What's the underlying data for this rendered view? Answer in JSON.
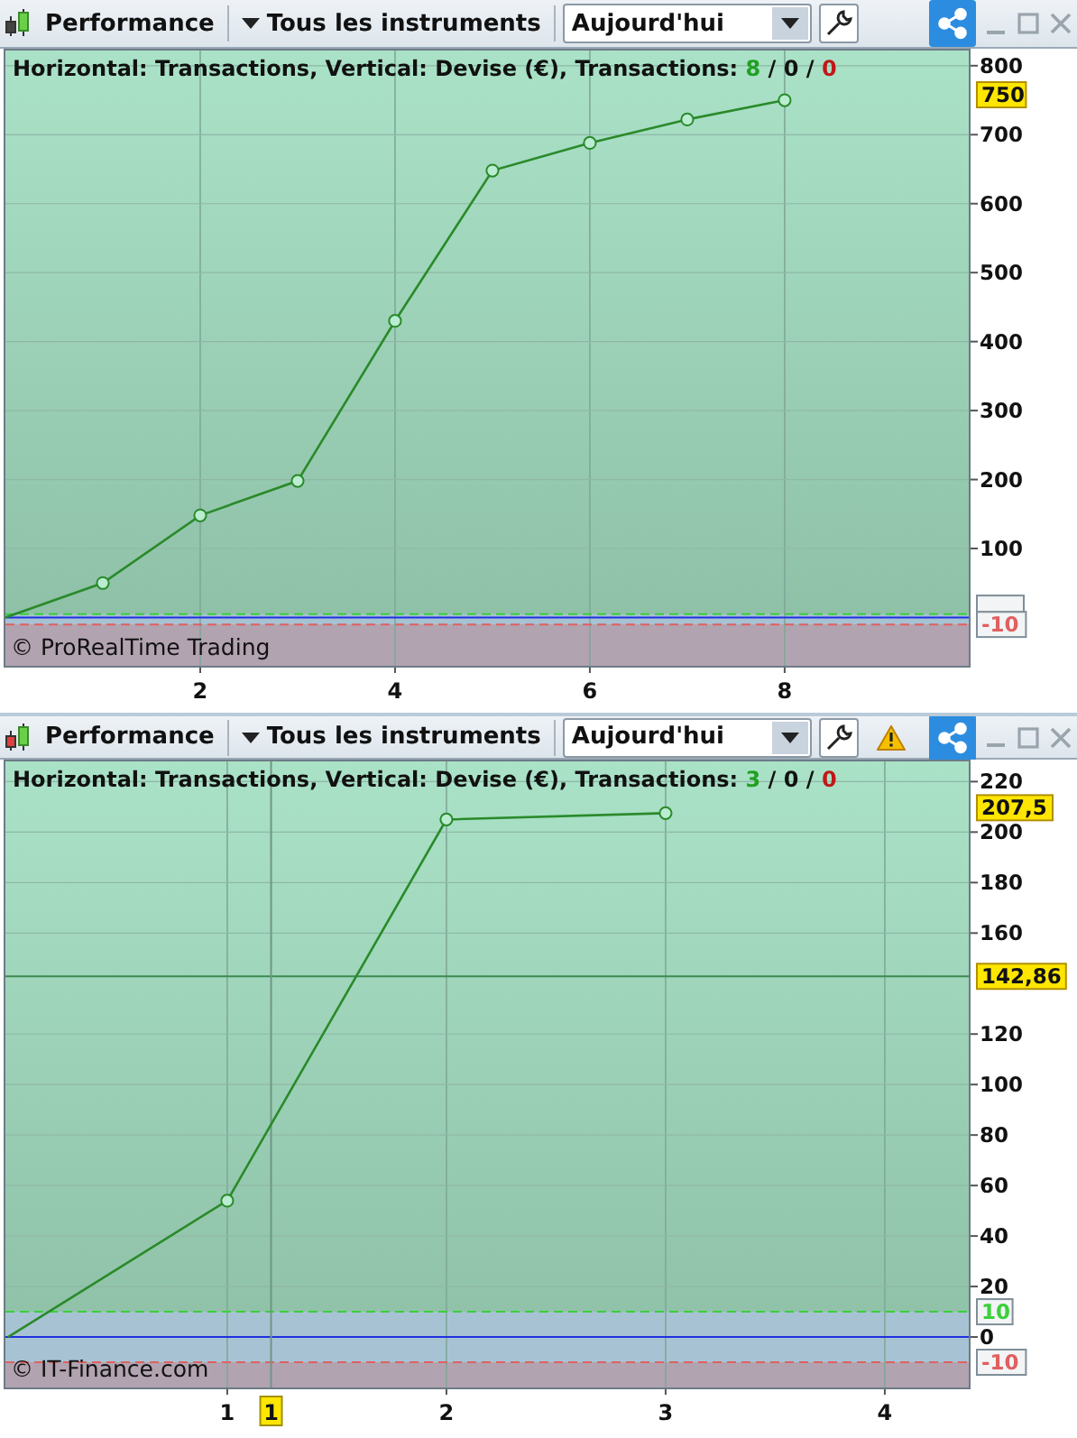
{
  "panels": [
    {
      "toolbar": {
        "title": "Performance",
        "instruments": "Tous les instruments",
        "period": "Aujourd'hui"
      },
      "caption": "Horizontal: Transactions, Vertical: Devise (€), Transactions:",
      "counts": [
        {
          "kind": "win",
          "text": "8"
        },
        {
          "kind": "neutral",
          "text": "0"
        },
        {
          "kind": "loss",
          "text": "0"
        }
      ],
      "count_separator": "/",
      "copyright": "© ProRealTime Trading",
      "chart_data": {
        "type": "line",
        "x": [
          0,
          1,
          2,
          3,
          4,
          5,
          6,
          7,
          8
        ],
        "series": [
          {
            "color": "#2a8a2a",
            "marker": "circle",
            "values": [
              0,
              50,
              148,
              198,
              430,
              648,
              688,
              722,
              750
            ]
          }
        ],
        "xlim": [
          0,
          9.89
        ],
        "ylim": [
          -70,
          822
        ],
        "xticks": [
          2,
          4,
          6,
          8
        ],
        "yticks": [
          100,
          200,
          300,
          400,
          500,
          600,
          700,
          800
        ],
        "grid": true,
        "bands": [
          {
            "axis": "y",
            "from": 5,
            "to": -10,
            "color": "#a7c3d3"
          },
          {
            "axis": "y",
            "from": -10,
            "to": -70,
            "color": "#b2a3b1"
          }
        ],
        "ref_lines": [
          {
            "axis": "y",
            "value": 5,
            "color": "#3ad03a"
          },
          {
            "axis": "y",
            "value": 0,
            "color": "#2030e0"
          },
          {
            "axis": "y",
            "value": -10,
            "color": "#e06060",
            "label": "-10"
          }
        ],
        "annotations": [
          "750"
        ]
      }
    },
    {
      "toolbar": {
        "title": "Performance",
        "instruments": "Tous les instruments",
        "period": "Aujourd'hui",
        "status_icons": [
          {
            "kind": "warning"
          }
        ]
      },
      "caption": "Horizontal: Transactions, Vertical: Devise (€), Transactions:",
      "counts": [
        {
          "kind": "win",
          "text": "3"
        },
        {
          "kind": "neutral",
          "text": "0"
        },
        {
          "kind": "loss",
          "text": "0"
        }
      ],
      "count_separator": "/",
      "copyright": "© IT-Finance.com",
      "chart_data": {
        "type": "line",
        "x": [
          0,
          1,
          2,
          3
        ],
        "series": [
          {
            "color": "#2a8a2a",
            "marker": "circle",
            "values": [
              0,
              54,
              205,
              207.5
            ]
          }
        ],
        "xlim": [
          -0.012,
          4.383
        ],
        "ylim": [
          -20,
          228
        ],
        "xticks": [
          1,
          2,
          3,
          4
        ],
        "yticks": [
          0,
          20,
          40,
          60,
          80,
          100,
          120,
          160,
          180,
          200,
          220
        ],
        "grid": true,
        "bands": [
          {
            "axis": "y",
            "from": 10,
            "to": -10,
            "color": "#a7c3d3"
          },
          {
            "axis": "y",
            "from": -10,
            "to": -20,
            "color": "#b2a3b1"
          }
        ],
        "ref_lines": [
          {
            "axis": "y",
            "value": 142.86,
            "color": "#3c8a50",
            "label": "142,86"
          },
          {
            "axis": "y",
            "value": 10,
            "color": "#3ad03a",
            "label": "10"
          },
          {
            "axis": "y",
            "value": 0,
            "color": "#2030e0"
          },
          {
            "axis": "y",
            "value": -10,
            "color": "#e06060",
            "label": "-10"
          },
          {
            "axis": "x",
            "value": 1.2,
            "color": "#6e9688",
            "label": "1"
          }
        ],
        "annotations": [
          "207,5"
        ]
      }
    }
  ]
}
